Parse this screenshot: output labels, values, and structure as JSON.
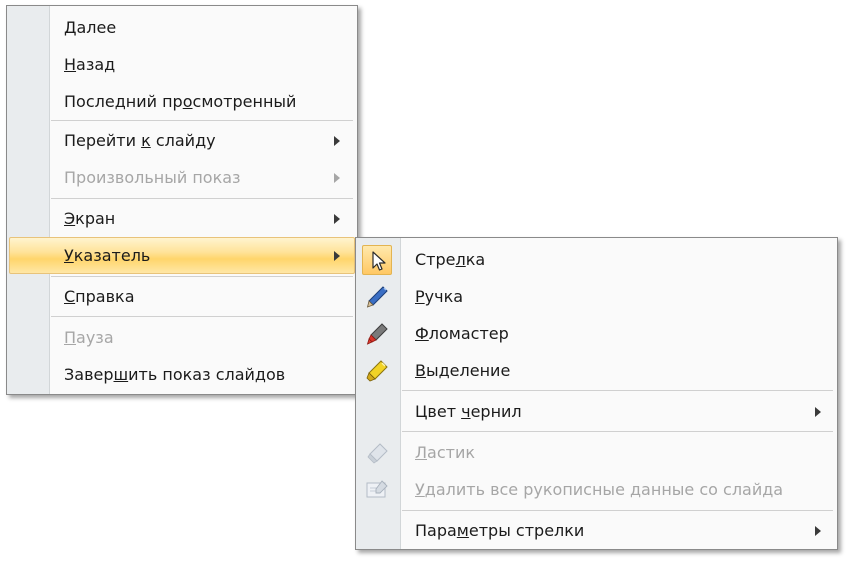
{
  "main_menu": {
    "items": [
      {
        "pre": "",
        "u": "Д",
        "post": "алее",
        "state": "normal"
      },
      {
        "pre": "",
        "u": "Н",
        "post": "азад",
        "state": "normal"
      },
      {
        "pre": "Последний пр",
        "u": "о",
        "post": "смотренный",
        "state": "normal"
      },
      {
        "pre": "Перейти ",
        "u": "к",
        "post": " слайду",
        "state": "normal",
        "submenu": true
      },
      {
        "pre": "Произвольный показ",
        "u": "",
        "post": "",
        "state": "disabled",
        "submenu": true
      },
      {
        "pre": "",
        "u": "Э",
        "post": "кран",
        "state": "normal",
        "submenu": true
      },
      {
        "pre": "",
        "u": "У",
        "post": "казатель",
        "state": "highlighted",
        "submenu": true
      },
      {
        "pre": "",
        "u": "С",
        "post": "правка",
        "state": "normal"
      },
      {
        "pre": "",
        "u": "П",
        "post": "ауза",
        "state": "disabled"
      },
      {
        "pre": "Завер",
        "u": "ш",
        "post": "ить показ слайдов",
        "state": "normal"
      }
    ]
  },
  "pointer_submenu": {
    "items": [
      {
        "pre": "Стре",
        "u": "л",
        "post": "ка",
        "icon": "arrow-cursor-icon",
        "state": "checked"
      },
      {
        "pre": "",
        "u": "Р",
        "post": "учка",
        "icon": "blue-pen-icon",
        "state": "normal"
      },
      {
        "pre": "",
        "u": "Ф",
        "post": "ломастер",
        "icon": "red-felt-tip-icon",
        "state": "normal"
      },
      {
        "pre": "",
        "u": "В",
        "post": "ыделение",
        "icon": "yellow-highlighter-icon",
        "state": "normal"
      },
      {
        "pre": "Цвет ",
        "u": "ч",
        "post": "ернил",
        "state": "normal",
        "submenu": true
      },
      {
        "pre": "",
        "u": "Л",
        "post": "астик",
        "icon": "eraser-icon",
        "state": "disabled"
      },
      {
        "pre": "",
        "u": "У",
        "post": "далить все рукописные данные со слайда",
        "icon": "erase-all-ink-icon",
        "state": "disabled"
      },
      {
        "pre": "Пара",
        "u": "м",
        "post": "етры стрелки",
        "state": "normal",
        "submenu": true
      }
    ]
  },
  "colors": {
    "highlight": "#ffd56b",
    "disabled_text": "#a6a6a6",
    "gutter": "#e9ecee"
  }
}
